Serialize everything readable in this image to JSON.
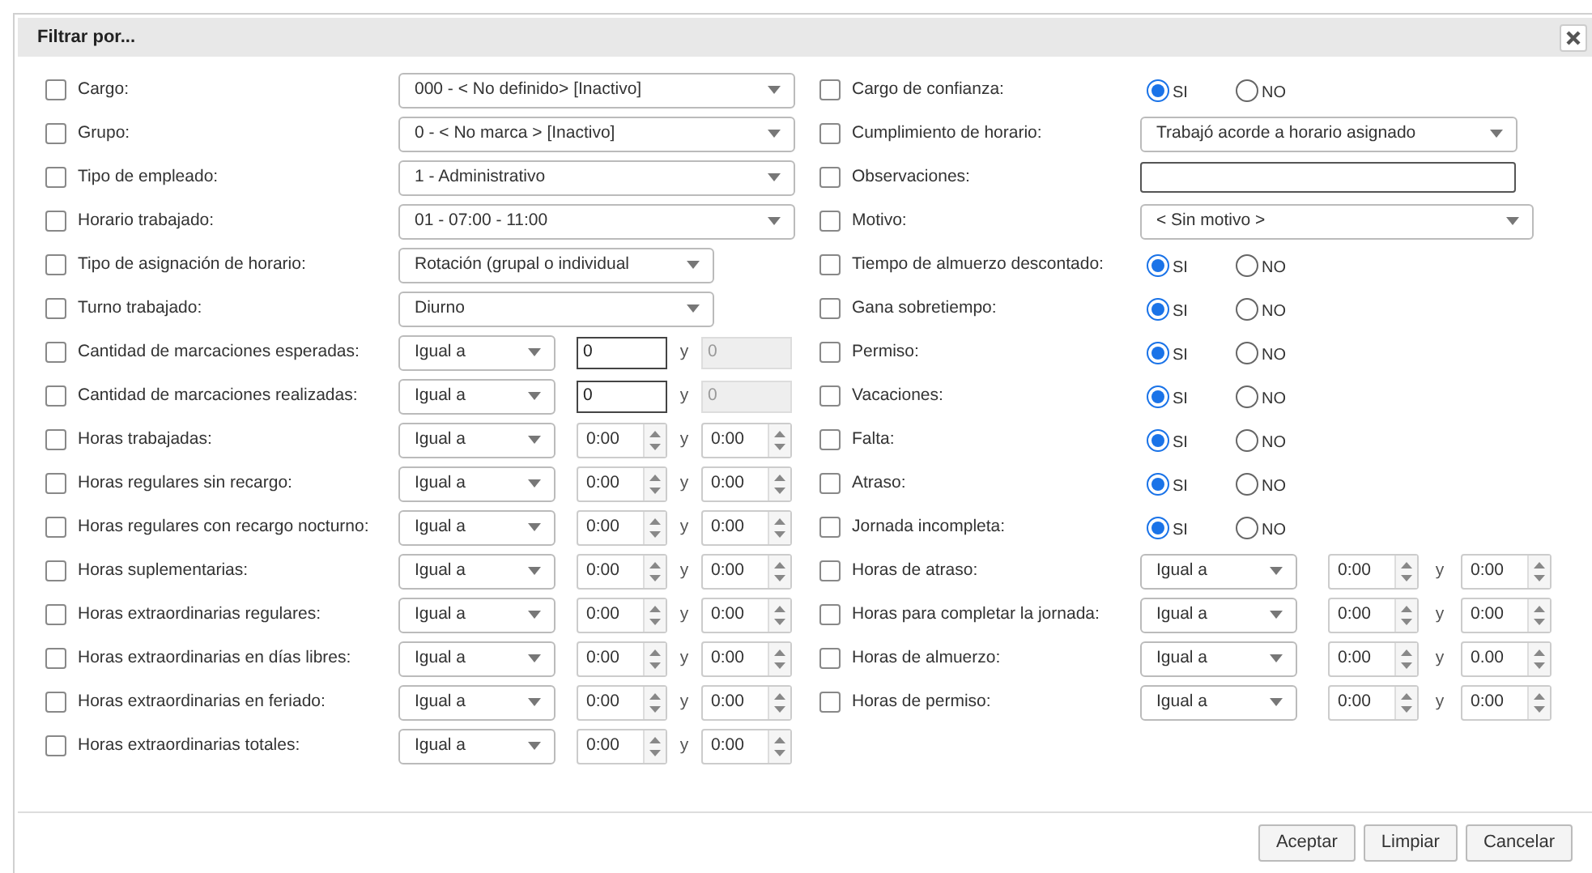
{
  "dialog": {
    "title": "Filtrar por..."
  },
  "left_rows": [
    {
      "kind": "select",
      "label": "Cargo:",
      "checked": false,
      "value": "000 - < No definido> [Inactivo]"
    },
    {
      "kind": "select",
      "label": "Grupo:",
      "checked": false,
      "value": "0 - < No marca > [Inactivo]"
    },
    {
      "kind": "select",
      "label": "Tipo de empleado:",
      "checked": false,
      "value": "1 - Administrativo"
    },
    {
      "kind": "select",
      "label": "Horario trabajado:",
      "checked": false,
      "value": "01 - 07:00 - 11:00"
    },
    {
      "kind": "select",
      "label": "Tipo de asignación de horario:",
      "checked": false,
      "value": "Rotación (grupal o individual"
    },
    {
      "kind": "select",
      "label": "Turno trabajado:",
      "checked": false,
      "value": "Diurno"
    },
    {
      "kind": "number_range",
      "label": "Cantidad de marcaciones esperadas:",
      "checked": false,
      "operator": "Igual a",
      "from": "0",
      "joiner": "y",
      "to": "0",
      "to_disabled": true
    },
    {
      "kind": "number_range",
      "label": "Cantidad de marcaciones realizadas:",
      "checked": false,
      "operator": "Igual a",
      "from": "0",
      "joiner": "y",
      "to": "0",
      "to_disabled": true
    },
    {
      "kind": "time_range",
      "label": "Horas trabajadas:",
      "checked": false,
      "operator": "Igual a",
      "from": "0:00",
      "joiner": "y",
      "to": "0:00"
    },
    {
      "kind": "time_range",
      "label": "Horas regulares sin recargo:",
      "checked": false,
      "operator": "Igual a",
      "from": "0:00",
      "joiner": "y",
      "to": "0:00"
    },
    {
      "kind": "time_range",
      "label": "Horas regulares con recargo nocturno:",
      "checked": false,
      "operator": "Igual a",
      "from": "0:00",
      "joiner": "y",
      "to": "0:00"
    },
    {
      "kind": "time_range",
      "label": "Horas suplementarias:",
      "checked": false,
      "operator": "Igual a",
      "from": "0:00",
      "joiner": "y",
      "to": "0:00"
    },
    {
      "kind": "time_range",
      "label": "Horas extraordinarias regulares:",
      "checked": false,
      "operator": "Igual a",
      "from": "0:00",
      "joiner": "y",
      "to": "0:00"
    },
    {
      "kind": "time_range",
      "label": "Horas extraordinarias en días libres:",
      "checked": false,
      "operator": "Igual a",
      "from": "0:00",
      "joiner": "y",
      "to": "0:00"
    },
    {
      "kind": "time_range",
      "label": "Horas extraordinarias en feriado:",
      "checked": false,
      "operator": "Igual a",
      "from": "0:00",
      "joiner": "y",
      "to": "0:00"
    },
    {
      "kind": "time_range",
      "label": "Horas extraordinarias totales:",
      "checked": false,
      "operator": "Igual a",
      "from": "0:00",
      "joiner": "y",
      "to": "0:00"
    }
  ],
  "right_rows": [
    {
      "kind": "radio",
      "label": "Cargo de confianza:",
      "checked": false,
      "options": [
        {
          "label": "SI",
          "selected": true
        },
        {
          "label": "NO",
          "selected": false
        }
      ]
    },
    {
      "kind": "select",
      "label": "Cumplimiento de horario:",
      "checked": false,
      "value": "Trabajó acorde a horario asignado"
    },
    {
      "kind": "text",
      "label": "Observaciones:",
      "checked": false
    },
    {
      "kind": "select",
      "label": "Motivo:",
      "checked": false,
      "value": "< Sin motivo >"
    },
    {
      "kind": "radio",
      "label": "Tiempo de almuerzo descontado:",
      "checked": false,
      "options": [
        {
          "label": "SI",
          "selected": true
        },
        {
          "label": "NO",
          "selected": false
        }
      ]
    },
    {
      "kind": "radio",
      "label": "Gana sobretiempo:",
      "checked": false,
      "options": [
        {
          "label": "SI",
          "selected": true
        },
        {
          "label": "NO",
          "selected": false
        }
      ]
    },
    {
      "kind": "radio",
      "label": "Permiso:",
      "checked": false,
      "options": [
        {
          "label": "SI",
          "selected": true
        },
        {
          "label": "NO",
          "selected": false
        }
      ]
    },
    {
      "kind": "radio",
      "label": "Vacaciones:",
      "checked": false,
      "options": [
        {
          "label": "SI",
          "selected": true
        },
        {
          "label": "NO",
          "selected": false
        }
      ]
    },
    {
      "kind": "radio",
      "label": "Falta:",
      "checked": false,
      "options": [
        {
          "label": "SI",
          "selected": true
        },
        {
          "label": "NO",
          "selected": false
        }
      ]
    },
    {
      "kind": "radio",
      "label": "Atraso:",
      "checked": false,
      "options": [
        {
          "label": "SI",
          "selected": true
        },
        {
          "label": "NO",
          "selected": false
        }
      ]
    },
    {
      "kind": "radio",
      "label": "Jornada incompleta:",
      "checked": false,
      "options": [
        {
          "label": "SI",
          "selected": true
        },
        {
          "label": "NO",
          "selected": false
        }
      ]
    },
    {
      "kind": "time_range",
      "label": "Horas de atraso:",
      "checked": false,
      "operator": "Igual a",
      "from": "0:00",
      "joiner": "y",
      "to": "0:00"
    },
    {
      "kind": "time_range",
      "label": "Horas para completar la jornada:",
      "checked": false,
      "operator": "Igual a",
      "from": "0:00",
      "joiner": "y",
      "to": "0:00"
    },
    {
      "kind": "time_range",
      "label": "Horas de almuerzo:",
      "checked": false,
      "operator": "Igual a",
      "from": "0:00",
      "joiner": "y",
      "to": "0.00"
    },
    {
      "kind": "time_range",
      "label": "Horas de permiso:",
      "checked": false,
      "operator": "Igual a",
      "from": "0:00",
      "joiner": "y",
      "to": "0:00"
    }
  ],
  "buttons": [
    {
      "label": "Aceptar"
    },
    {
      "label": "Limpiar"
    },
    {
      "label": "Cancelar"
    }
  ]
}
